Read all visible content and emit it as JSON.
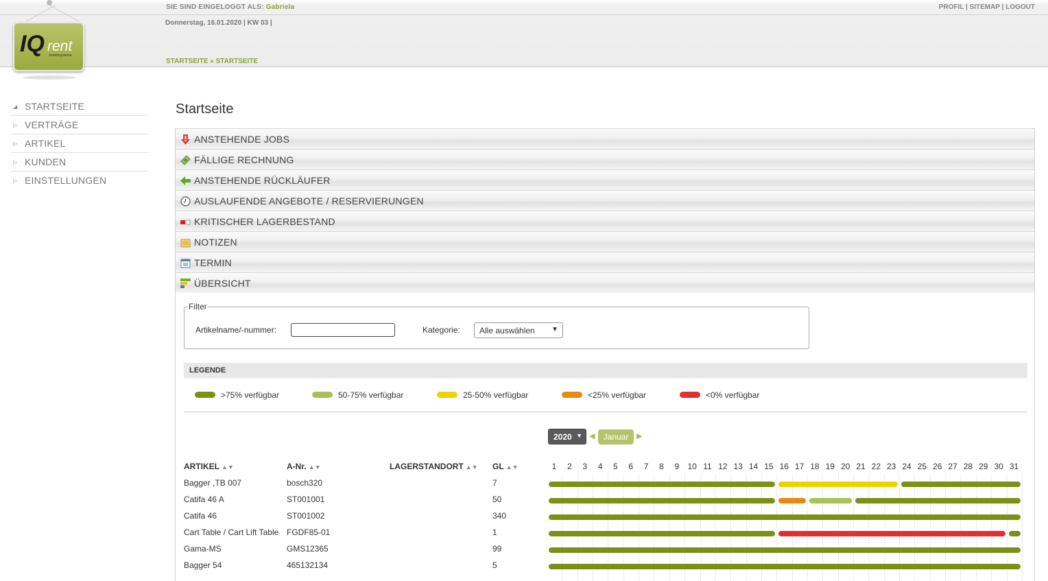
{
  "header": {
    "logged_in_label": "SIE SIND EINGELOGGT ALS:",
    "user_name": "Gabriela",
    "links": [
      "PROFIL",
      "SITEMAP",
      "LOGOUT"
    ],
    "date_line": "Donnerstag, 16.01.2020 | KW 03 |",
    "breadcrumb": [
      "STARTSEITE",
      "STARTSEITE"
    ],
    "breadcrumb_sep": "»",
    "logo": {
      "main": "IQ",
      "sub": "rent",
      "tagline": "Verleihsysteme"
    }
  },
  "sidebar": {
    "items": [
      {
        "label": "STARTSEITE",
        "active": true
      },
      {
        "label": "VERTRÄGE",
        "active": false
      },
      {
        "label": "ARTIKEL",
        "active": false
      },
      {
        "label": "KUNDEN",
        "active": false
      },
      {
        "label": "EINSTELLUNGEN",
        "active": false
      }
    ]
  },
  "main": {
    "title": "Startseite",
    "accordion": [
      {
        "label": "ANSTEHENDE JOBS",
        "icon": "alert-down-icon"
      },
      {
        "label": "FÄLLIGE RECHNUNG",
        "icon": "money-icon"
      },
      {
        "label": "ANSTEHENDE RÜCKLÄUFER",
        "icon": "arrow-left-icon"
      },
      {
        "label": "AUSLAUFENDE ANGEBOTE / RESERVIERUNGEN",
        "icon": "clock-icon"
      },
      {
        "label": "KRITISCHER LAGERBESTAND",
        "icon": "stock-icon"
      },
      {
        "label": "NOTIZEN",
        "icon": "note-icon"
      },
      {
        "label": "TERMIN",
        "icon": "calendar-icon"
      },
      {
        "label": "ÜBERSICHT",
        "icon": "chart-icon"
      }
    ],
    "filter": {
      "title": "Filter",
      "article_label": "Artikelname/-nummer:",
      "article_value": "",
      "category_label": "Kategorie:",
      "category_value": "Alle auswählen"
    },
    "legend": {
      "title": "LEGENDE",
      "items": [
        {
          "label": ">75% verfügbar",
          "color": "#7b9116"
        },
        {
          "label": "50-75% verfügbar",
          "color": "#a8c256"
        },
        {
          "label": "25-50% verfügbar",
          "color": "#eed200"
        },
        {
          "label": "<25% verfügbar",
          "color": "#e88a10"
        },
        {
          "label": "<0% verfügbar",
          "color": "#e03030"
        }
      ]
    },
    "calendar": {
      "year": "2020",
      "month": "Januar",
      "days": [
        "1",
        "2",
        "3",
        "4",
        "5",
        "6",
        "7",
        "8",
        "9",
        "10",
        "11",
        "12",
        "13",
        "14",
        "15",
        "16",
        "17",
        "18",
        "19",
        "20",
        "21",
        "22",
        "23",
        "24",
        "25",
        "26",
        "27",
        "28",
        "29",
        "30",
        "31"
      ]
    },
    "table": {
      "headers": {
        "article": "ARTIKEL",
        "number": "A-Nr.",
        "location": "LAGERSTANDORT",
        "gl": "GL"
      },
      "rows": [
        {
          "article": "Bagger ,TB 007",
          "number": "bosch320",
          "location": "",
          "gl": "7",
          "segments": [
            {
              "from": 1,
              "to": 15,
              "level": 0
            },
            {
              "from": 16,
              "to": 23,
              "level": 2
            },
            {
              "from": 24,
              "to": 31,
              "level": 0
            }
          ]
        },
        {
          "article": "Catifa 46 A",
          "number": "ST001001",
          "location": "",
          "gl": "50",
          "segments": [
            {
              "from": 1,
              "to": 15,
              "level": 0
            },
            {
              "from": 16,
              "to": 17,
              "level": 3
            },
            {
              "from": 18,
              "to": 20,
              "level": 1
            },
            {
              "from": 21,
              "to": 31,
              "level": 0
            }
          ]
        },
        {
          "article": "Catifa 46",
          "number": "ST001002",
          "location": "",
          "gl": "340",
          "segments": [
            {
              "from": 1,
              "to": 31,
              "level": 0
            }
          ]
        },
        {
          "article": "Cart Table / Cart Lift Table",
          "number": "FGDF85-01",
          "location": "",
          "gl": "1",
          "segments": [
            {
              "from": 1,
              "to": 15,
              "level": 0
            },
            {
              "from": 16,
              "to": 30,
              "level": 4
            },
            {
              "from": 31,
              "to": 31,
              "level": 0
            }
          ]
        },
        {
          "article": "Gama-MS",
          "number": "GMS12365",
          "location": "",
          "gl": "99",
          "segments": [
            {
              "from": 1,
              "to": 31,
              "level": 0
            }
          ]
        },
        {
          "article": "Bagger 54",
          "number": "465132134",
          "location": "",
          "gl": "5",
          "segments": [
            {
              "from": 1,
              "to": 31,
              "level": 0
            }
          ]
        }
      ]
    }
  }
}
